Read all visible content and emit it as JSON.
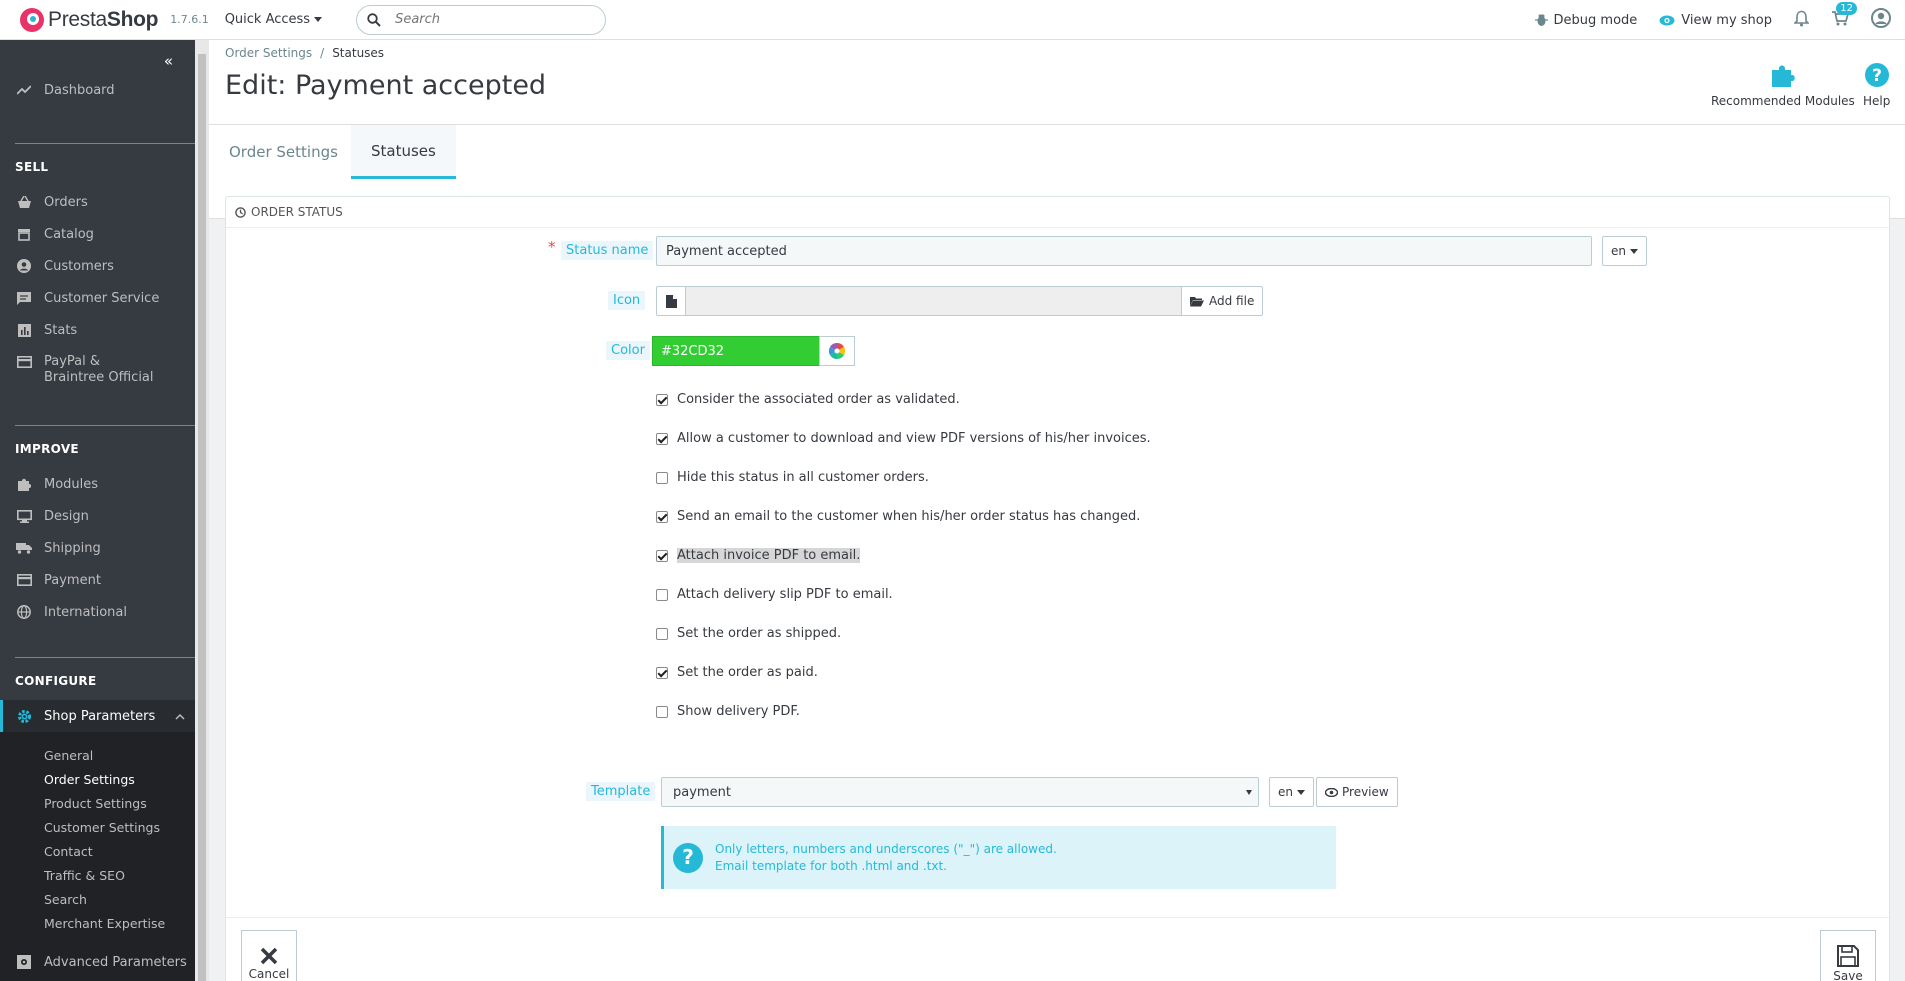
{
  "header": {
    "brand_light": "Presta",
    "brand_bold": "Shop",
    "version": "1.7.6.1",
    "quick_access": "Quick Access",
    "search_placeholder": "Search",
    "debug_mode": "Debug mode",
    "view_shop": "View my shop",
    "cart_badge": "12"
  },
  "sidebar": {
    "dashboard": "Dashboard",
    "sell_title": "SELL",
    "sell_items": [
      "Orders",
      "Catalog",
      "Customers",
      "Customer Service",
      "Stats",
      "PayPal & Braintree Official"
    ],
    "improve_title": "IMPROVE",
    "improve_items": [
      "Modules",
      "Design",
      "Shipping",
      "Payment",
      "International"
    ],
    "configure_title": "CONFIGURE",
    "shop_parameters": "Shop Parameters",
    "sub_items": [
      "General",
      "Order Settings",
      "Product Settings",
      "Customer Settings",
      "Contact",
      "Traffic & SEO",
      "Search",
      "Merchant Expertise"
    ],
    "advanced_parameters": "Advanced Parameters"
  },
  "page": {
    "breadcrumb_parent": "Order Settings",
    "breadcrumb_current": "Statuses",
    "title": "Edit: Payment accepted",
    "recommended_modules": "Recommended Modules",
    "help": "Help",
    "tabs": [
      "Order Settings",
      "Statuses"
    ]
  },
  "form": {
    "panel_title": "ORDER STATUS",
    "status_name_label": "Status name",
    "status_name_value": "Payment accepted",
    "lang": "en",
    "icon_label": "Icon",
    "add_file": "Add file",
    "color_label": "Color",
    "color_value": "#32CD32",
    "checkboxes": [
      {
        "label": "Consider the associated order as validated.",
        "checked": true
      },
      {
        "label": "Allow a customer to download and view PDF versions of his/her invoices.",
        "checked": true
      },
      {
        "label": "Hide this status in all customer orders.",
        "checked": false
      },
      {
        "label": "Send an email to the customer when his/her order status has changed.",
        "checked": true
      },
      {
        "label": "Attach invoice PDF to email.",
        "checked": true
      },
      {
        "label": "Attach delivery slip PDF to email.",
        "checked": false
      },
      {
        "label": "Set the order as shipped.",
        "checked": false
      },
      {
        "label": "Set the order as paid.",
        "checked": true
      },
      {
        "label": "Show delivery PDF.",
        "checked": false
      }
    ],
    "template_label": "Template",
    "template_value": "payment",
    "preview": "Preview",
    "info_line1": "Only letters, numbers and underscores (\"_\") are allowed.",
    "info_line2": "Email template for both .html and .txt.",
    "cancel": "Cancel",
    "save": "Save"
  },
  "colors": {
    "accent": "#25b9d7",
    "sidebar_bg": "#363a41",
    "status_color": "#32CD32"
  }
}
